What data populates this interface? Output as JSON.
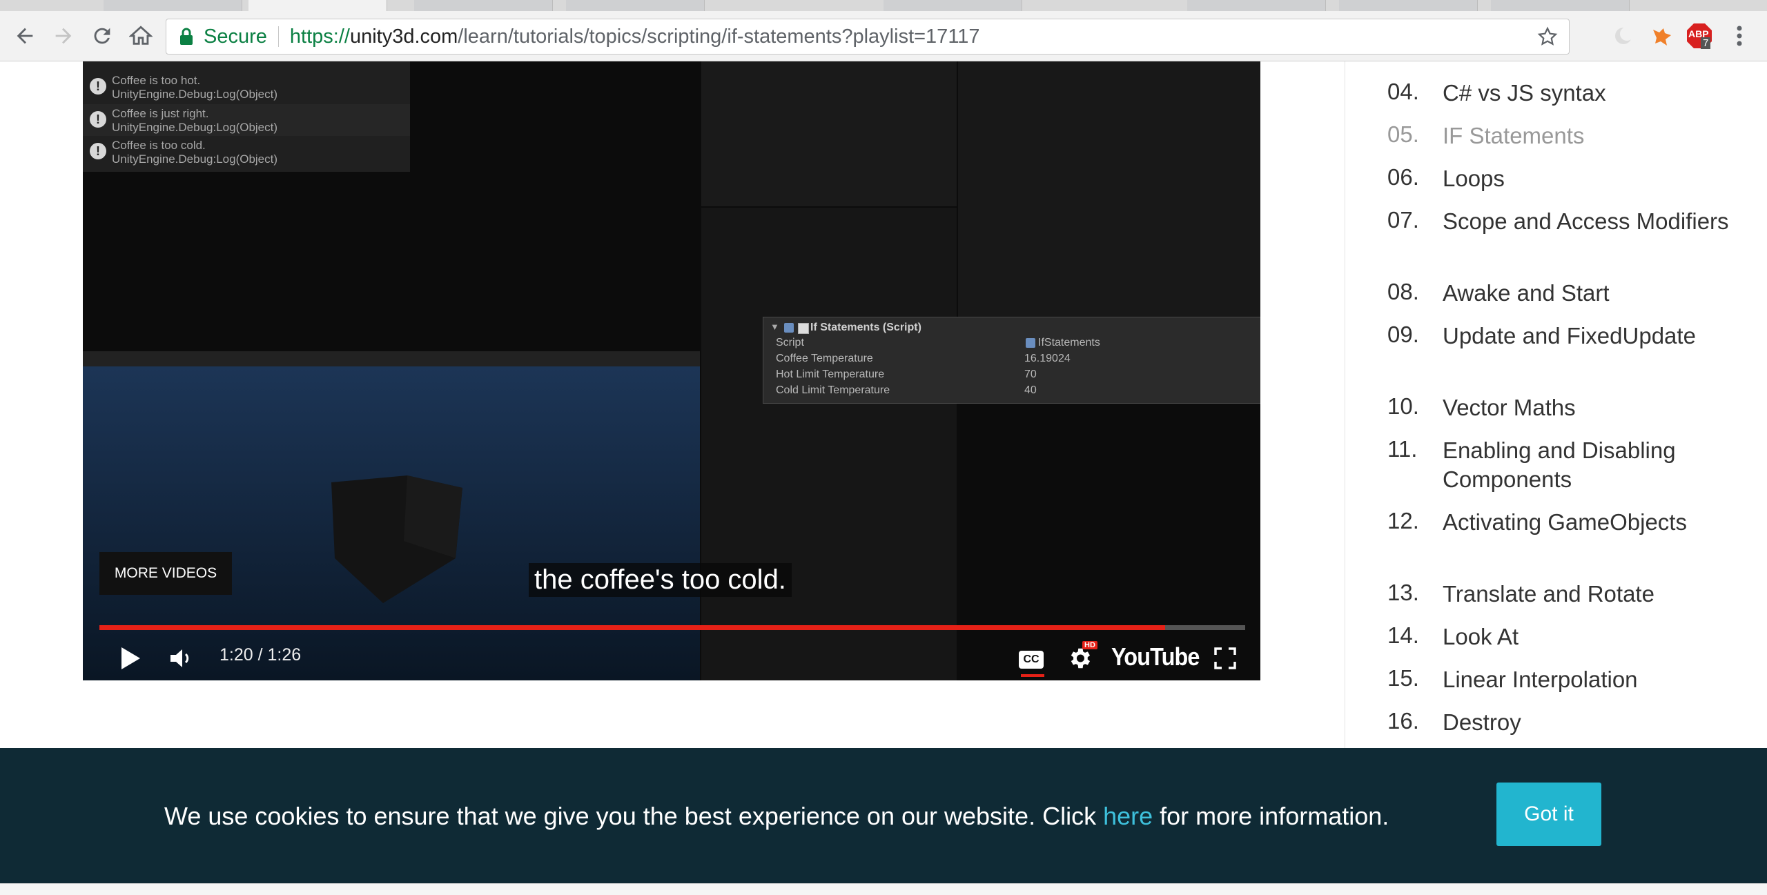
{
  "browser": {
    "secure_label": "Secure",
    "url_scheme": "https://",
    "url_host": "unity3d.com",
    "url_path": "/learn/tutorials/topics/scripting/if-statements?playlist=17117",
    "extension_badge": "ABP",
    "extension_count": "7"
  },
  "video": {
    "console_logs": [
      {
        "message": "Coffee is too hot.",
        "detail": "UnityEngine.Debug:Log(Object)"
      },
      {
        "message": "Coffee is just right.",
        "detail": "UnityEngine.Debug:Log(Object)"
      },
      {
        "message": "Coffee is too cold.",
        "detail": "UnityEngine.Debug:Log(Object)"
      }
    ],
    "inspector": {
      "title": "If Statements (Script)",
      "fields": [
        {
          "label": "Script",
          "value": "IfStatements"
        },
        {
          "label": "Coffee Temperature",
          "value": "16.19024"
        },
        {
          "label": "Hot Limit Temperature",
          "value": "70"
        },
        {
          "label": "Cold Limit Temperature",
          "value": "40"
        }
      ]
    },
    "more_videos_label": "MORE VIDEOS",
    "caption": "the coffee's too cold.",
    "time": "1:20 / 1:26",
    "progress_fraction": 0.93,
    "youtube_label": "YouTube",
    "hd_badge": "HD",
    "cc_label": "CC"
  },
  "sidebar": {
    "lessons": [
      {
        "num": "04.",
        "title": "C# vs JS syntax",
        "current": false
      },
      {
        "num": "05.",
        "title": "IF Statements",
        "current": true
      },
      {
        "num": "06.",
        "title": "Loops",
        "current": false
      },
      {
        "num": "07.",
        "title": "Scope and Access Modifiers",
        "current": false
      },
      {
        "num": "08.",
        "title": "Awake and Start",
        "current": false
      },
      {
        "num": "09.",
        "title": "Update and FixedUpdate",
        "current": false
      },
      {
        "num": "10.",
        "title": "Vector Maths",
        "current": false
      },
      {
        "num": "11.",
        "title": "Enabling and Disabling Components",
        "current": false
      },
      {
        "num": "12.",
        "title": "Activating GameObjects",
        "current": false
      },
      {
        "num": "13.",
        "title": "Translate and Rotate",
        "current": false
      },
      {
        "num": "14.",
        "title": "Look At",
        "current": false
      },
      {
        "num": "15.",
        "title": "Linear Interpolation",
        "current": false
      },
      {
        "num": "16.",
        "title": "Destroy",
        "current": false
      }
    ]
  },
  "cookie": {
    "message_before": "We use cookies to ensure that we give you the best experience on our website. Click ",
    "link_text": "here",
    "message_after": " for more information.",
    "button_label": "Got it"
  },
  "colors": {
    "accent": "#22b5cf",
    "banner_bg": "#0f2a35",
    "secure_green": "#0b8043",
    "progress_red": "#e62117"
  }
}
